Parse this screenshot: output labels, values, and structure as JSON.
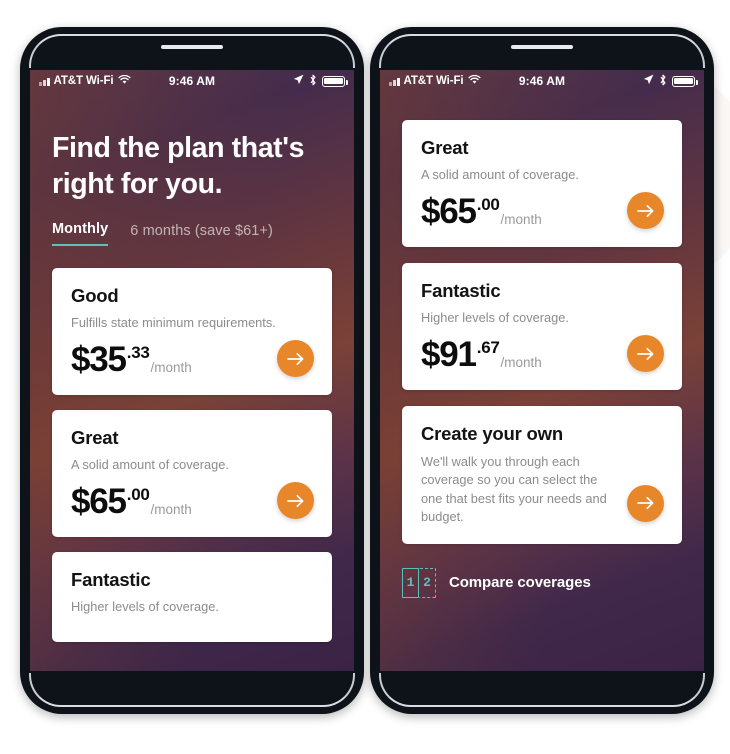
{
  "page": {
    "background": "#ffffff",
    "accent_orange": "#e8862a",
    "accent_teal": "#5cc1ba",
    "screen_gradient_from": "#4b3150",
    "screen_gradient_mid": "#7a4238",
    "screen_gradient_to": "#3a2345"
  },
  "status_bar": {
    "carrier": "AT&T Wi-Fi",
    "time": "9:46 AM",
    "signal_icon": "signal-bars-icon",
    "wifi_icon": "wifi-icon",
    "location_icon": "location-arrow-icon",
    "bluetooth_icon": "bluetooth-icon",
    "battery_icon": "battery-icon"
  },
  "phone_left": {
    "hero": {
      "headline_line1": "Find the plan that's",
      "headline_line2": "right for you."
    },
    "tabs": [
      {
        "label": "Monthly",
        "active": true
      },
      {
        "label": "6 months (save $61+)",
        "active": false
      }
    ],
    "cards": [
      {
        "title": "Good",
        "desc": "Fulfills state minimum requirements.",
        "price_main": "$35",
        "price_cents": ".33",
        "price_per": "/month",
        "cta_icon": "arrow-right-icon"
      },
      {
        "title": "Great",
        "desc": "A solid amount of coverage.",
        "price_main": "$65",
        "price_cents": ".00",
        "price_per": "/month",
        "cta_icon": "arrow-right-icon"
      },
      {
        "title": "Fantastic",
        "desc": "Higher levels of coverage.",
        "price_main": "",
        "price_cents": "",
        "price_per": "",
        "cta_icon": "arrow-right-icon"
      }
    ]
  },
  "phone_right": {
    "cards": [
      {
        "title": "Great",
        "desc": "A solid amount of coverage.",
        "price_main": "$65",
        "price_cents": ".00",
        "price_per": "/month",
        "cta_icon": "arrow-right-icon"
      },
      {
        "title": "Fantastic",
        "desc": "Higher levels of coverage.",
        "price_main": "$91",
        "price_cents": ".67",
        "price_per": "/month",
        "cta_icon": "arrow-right-icon"
      },
      {
        "title": "Create your own",
        "desc": "We'll walk you through each coverage so you can select the one that best fits your needs and budget.",
        "price_main": "",
        "price_cents": "",
        "price_per": "",
        "cta_icon": "arrow-right-icon"
      }
    ],
    "compare": {
      "label": "Compare coverages",
      "icon": "compare-pages-icon",
      "box_one": "1",
      "box_two": "2"
    }
  }
}
